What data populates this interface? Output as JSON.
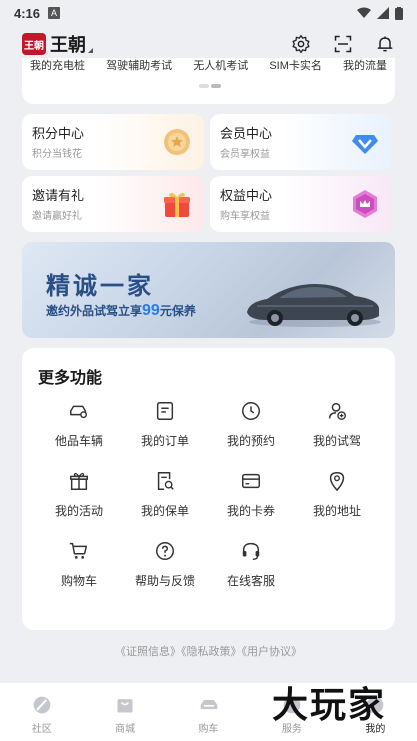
{
  "status": {
    "time": "4:16",
    "badge": "A"
  },
  "header": {
    "logo_text": "王朝",
    "brand": "王朝"
  },
  "shortcuts": {
    "items": [
      "我的充电桩",
      "驾驶辅助考试",
      "无人机考试",
      "SIM卡实名",
      "我的流量"
    ]
  },
  "member_cards": [
    {
      "title": "积分中心",
      "sub": "积分当钱花"
    },
    {
      "title": "会员中心",
      "sub": "会员享权益"
    },
    {
      "title": "邀请有礼",
      "sub": "邀请赢好礼"
    },
    {
      "title": "权益中心",
      "sub": "购车享权益"
    }
  ],
  "banner": {
    "title": "精诚一家",
    "sub_pre": "邀约外品试驾立享",
    "sub_num": "99",
    "sub_post": "元保养"
  },
  "more": {
    "title": "更多功能",
    "items": [
      {
        "label": "他品车辆",
        "icon": "car-icon"
      },
      {
        "label": "我的订单",
        "icon": "order-icon"
      },
      {
        "label": "我的预约",
        "icon": "clock-icon"
      },
      {
        "label": "我的试驾",
        "icon": "user-add-icon"
      },
      {
        "label": "我的活动",
        "icon": "gift-icon"
      },
      {
        "label": "我的保单",
        "icon": "policy-search-icon"
      },
      {
        "label": "我的卡券",
        "icon": "card-icon"
      },
      {
        "label": "我的地址",
        "icon": "location-icon"
      },
      {
        "label": "购物车",
        "icon": "cart-icon"
      },
      {
        "label": "帮助与反馈",
        "icon": "help-icon"
      },
      {
        "label": "在线客服",
        "icon": "headset-icon"
      }
    ]
  },
  "footer": {
    "links": "《证照信息》《隐私政策》《用户协议》"
  },
  "tabs": [
    {
      "label": "社区",
      "icon": "community-icon"
    },
    {
      "label": "商城",
      "icon": "mall-icon"
    },
    {
      "label": "购车",
      "icon": "car-icon"
    },
    {
      "label": "服务",
      "icon": "service-icon"
    },
    {
      "label": "我的",
      "icon": "profile-icon"
    }
  ],
  "watermark": "大玩家",
  "colors": {
    "brand_red": "#c2182b",
    "banner_text": "#2a4f86",
    "banner_highlight": "#2c7de6"
  }
}
